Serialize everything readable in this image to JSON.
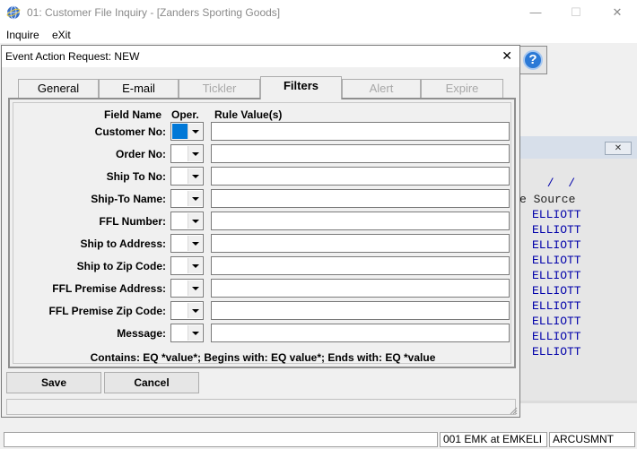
{
  "window": {
    "title": "01: Customer File Inquiry - [Zanders Sporting Goods]",
    "minimize": "—",
    "maximize": "☐",
    "close": "✕"
  },
  "menu": [
    "Inquire",
    "eXit"
  ],
  "help_button": "?",
  "background": {
    "close_glyph": "✕",
    "slash_text": " /  /",
    "source_header": "e Source",
    "source_values": [
      "ELLIOTT",
      "ELLIOTT",
      "ELLIOTT",
      "ELLIOTT",
      "ELLIOTT",
      "ELLIOTT",
      "ELLIOTT",
      "ELLIOTT",
      "ELLIOTT",
      "ELLIOTT"
    ]
  },
  "statusbar": {
    "user": "001 EMK at EMKELI",
    "program": "ARCUSMNT"
  },
  "dialog": {
    "title": "Event Action Request: NEW",
    "close": "✕",
    "tabs": [
      {
        "label": "General",
        "state": "normal"
      },
      {
        "label": "E-mail",
        "state": "normal"
      },
      {
        "label": "Tickler",
        "state": "disabled"
      },
      {
        "label": "Filters",
        "state": "active"
      },
      {
        "label": "Alert",
        "state": "disabled"
      },
      {
        "label": "Expire",
        "state": "disabled"
      }
    ],
    "headers": {
      "field_name": "Field Name",
      "oper": "Oper.",
      "rule_value": "Rule Value(s)"
    },
    "fields": [
      {
        "label": "Customer No:",
        "oper": "",
        "value": "",
        "selected": true
      },
      {
        "label": "Order No:",
        "oper": "",
        "value": ""
      },
      {
        "label": "Ship To No:",
        "oper": "",
        "value": ""
      },
      {
        "label": "Ship-To Name:",
        "oper": "",
        "value": ""
      },
      {
        "label": "FFL Number:",
        "oper": "",
        "value": ""
      },
      {
        "label": "Ship to Address:",
        "oper": "",
        "value": ""
      },
      {
        "label": "Ship to Zip Code:",
        "oper": "",
        "value": ""
      },
      {
        "label": "FFL Premise Address:",
        "oper": "",
        "value": ""
      },
      {
        "label": "FFL Premise Zip Code:",
        "oper": "",
        "value": ""
      },
      {
        "label": "Message:",
        "oper": "",
        "value": ""
      }
    ],
    "help_text": "Contains: EQ *value*;  Begins with: EQ value*;  Ends with: EQ *value",
    "save_label": "Save",
    "cancel_label": "Cancel"
  }
}
